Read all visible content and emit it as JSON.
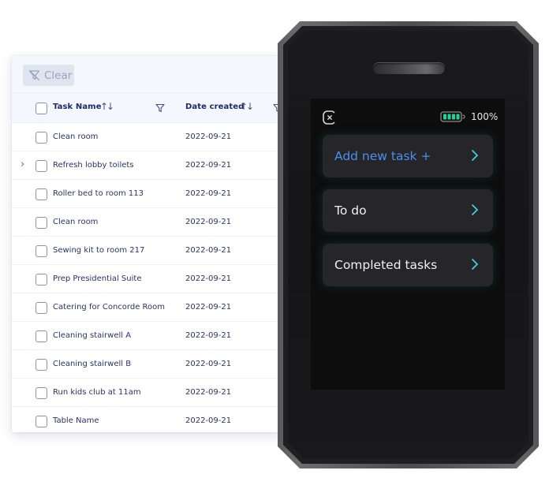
{
  "table": {
    "toolbar": {
      "clear_label": "Clear",
      "clear_icon": "filter-clear-icon"
    },
    "columns": [
      {
        "label": "Task Name",
        "sort_icon": "sort-up-down-icon",
        "filter_icon": "filter-icon"
      },
      {
        "label": "Date created",
        "sort_icon": "sort-up-down-icon",
        "filter_icon": "filter-icon"
      }
    ],
    "sort_glyph": "↑↓",
    "expander_glyph": "›",
    "rows": [
      {
        "task": "Clean room",
        "date": "2022-09-21",
        "expandable": false
      },
      {
        "task": "Refresh lobby toilets",
        "date": "2022-09-21",
        "expandable": true
      },
      {
        "task": "Roller bed to room 113",
        "date": "2022-09-21",
        "expandable": false
      },
      {
        "task": "Clean room",
        "date": "2022-09-21",
        "expandable": false
      },
      {
        "task": "Sewing kit to room 217",
        "date": "2022-09-21",
        "expandable": false
      },
      {
        "task": "Prep Presidential Suite",
        "date": "2022-09-21",
        "expandable": false
      },
      {
        "task": "Catering for Concorde Room",
        "date": "2022-09-21",
        "expandable": false
      },
      {
        "task": "Cleaning stairwell A",
        "date": "2022-09-21",
        "expandable": false
      },
      {
        "task": "Cleaning stairwell B",
        "date": "2022-09-21",
        "expandable": false
      },
      {
        "task": "Run kids club at 11am",
        "date": "2022-09-21",
        "expandable": false
      },
      {
        "task": "Table Name",
        "date": "2022-09-21",
        "expandable": false
      }
    ]
  },
  "device": {
    "status": {
      "close_icon": "close-icon",
      "battery_icon": "battery-full-icon",
      "battery_level": "100%",
      "battery_percent": 100
    },
    "menu": [
      {
        "label": "Add new task +",
        "icon": "chevron-right-icon",
        "highlight": true
      },
      {
        "label": "To do",
        "icon": "chevron-right-icon",
        "highlight": false
      },
      {
        "label": "Completed tasks",
        "icon": "chevron-right-icon",
        "highlight": false
      }
    ]
  },
  "colors": {
    "table_text": "#27336e",
    "table_header_text": "#1d2a6b",
    "accent_blue": "#4a8ef0",
    "chevron_teal": "#3fd6e0",
    "battery_green": "#1fd49a"
  }
}
